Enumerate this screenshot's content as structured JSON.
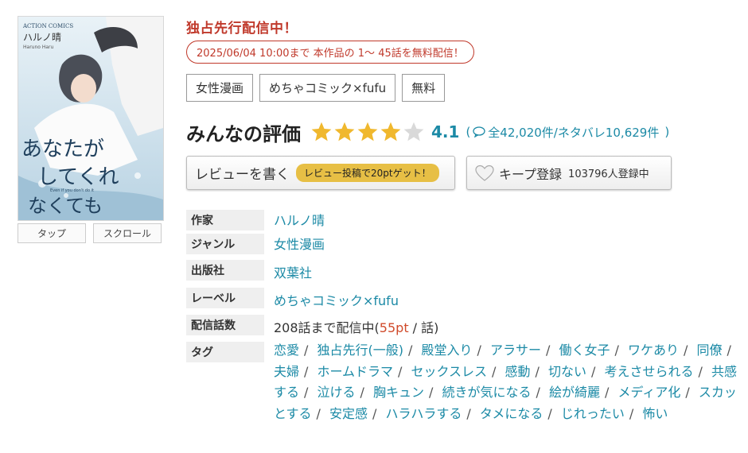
{
  "cover": {
    "publisher_mark": "ACTION COMICS",
    "author_on_cover": "ハルノ晴",
    "author_romaji": "Haruno Haru",
    "title_line1": "あなたが",
    "title_line2": "してくれ",
    "title_line3": "なくても",
    "subtitle_en": "Even if you don't do it",
    "buttons": [
      "タップ",
      "スクロール"
    ]
  },
  "promo": {
    "exclusive": "独占先行配信中！",
    "free_notice": "2025/06/04 10:00まで 本作品の 1～ 45話を無料配信！"
  },
  "chips": [
    "女性漫画",
    "めちゃコミック×fufu",
    "無料"
  ],
  "rating": {
    "title": "みんなの評価",
    "stars_filled": 4,
    "stars_total": 5,
    "score": "4.1",
    "open_paren": "(",
    "count_text": "全42,020件/ネタバレ10,629件",
    "close_paren": ")",
    "colors": {
      "star_on": "#f0b82e",
      "star_off": "#d9d9d9",
      "accent": "#1c8aa6"
    }
  },
  "actions": {
    "review_label": "レビューを書く",
    "review_badge": "レビュー投稿で20ptゲット！",
    "keep_label": "キープ登録",
    "keep_count": "103796人登録中"
  },
  "info": {
    "author_label": "作家",
    "author": "ハルノ晴",
    "genre_label": "ジャンル",
    "genre": "女性漫画",
    "publisher_label": "出版社",
    "publisher": "双葉社",
    "label_label": "レーベル",
    "label": "めちゃコミック×fufu",
    "episodes_label": "配信話数",
    "episodes_prefix": "208話まで配信中(",
    "episodes_pt": "55pt",
    "episodes_suffix": " / 話)",
    "tags_label": "タグ",
    "tags": [
      "恋愛",
      "独占先行(一般)",
      "殿堂入り",
      "アラサー",
      "働く女子",
      "ワケあり",
      "同僚",
      "夫婦",
      "ホームドラマ",
      "セックスレス",
      "感動",
      "切ない",
      "考えさせられる",
      "共感する",
      "泣ける",
      "胸キュン",
      "続きが気になる",
      "絵が綺麗",
      "メディア化",
      "スカッとする",
      "安定感",
      "ハラハラする",
      "タメになる",
      "じれったい",
      "怖い"
    ]
  }
}
